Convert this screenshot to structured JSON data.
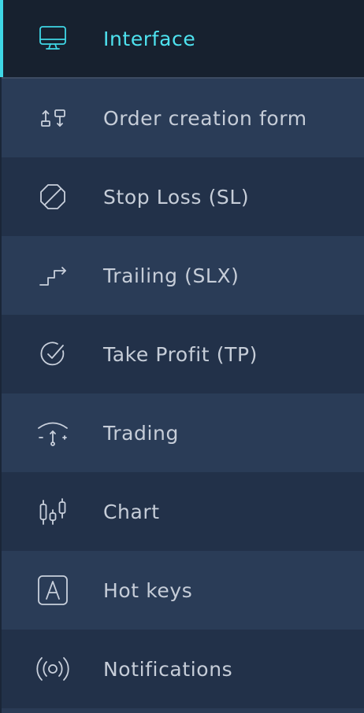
{
  "menu": {
    "active_index": 0,
    "accent_color": "#3fd7e6",
    "items": [
      {
        "label": "Interface",
        "icon": "monitor-icon"
      },
      {
        "label": "Order creation form",
        "icon": "order-form-icon"
      },
      {
        "label": "Stop Loss (SL)",
        "icon": "stop-loss-icon"
      },
      {
        "label": "Trailing (SLX)",
        "icon": "trailing-stairs-icon"
      },
      {
        "label": "Take Profit (TP)",
        "icon": "take-profit-check-icon"
      },
      {
        "label": "Trading",
        "icon": "trading-gauge-icon"
      },
      {
        "label": "Chart",
        "icon": "candlestick-chart-icon"
      },
      {
        "label": "Hot keys",
        "icon": "hot-keys-icon"
      },
      {
        "label": "Notifications",
        "icon": "notifications-broadcast-icon"
      }
    ]
  }
}
